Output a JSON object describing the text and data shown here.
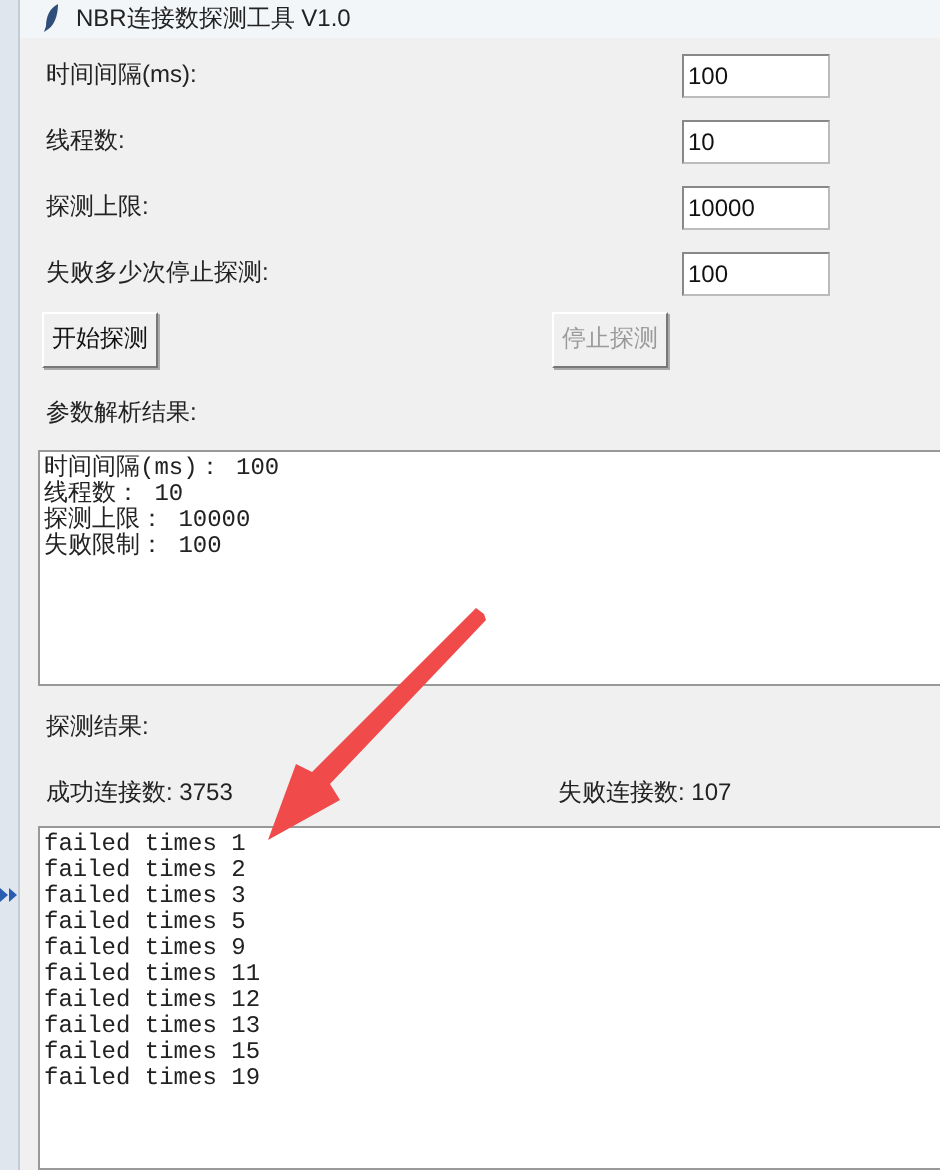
{
  "window": {
    "title": "NBR连接数探测工具 V1.0"
  },
  "fields": [
    {
      "label": "时间间隔(ms):",
      "value": "100"
    },
    {
      "label": "线程数:",
      "value": "10"
    },
    {
      "label": "探测上限:",
      "value": "10000"
    },
    {
      "label": "失败多少次停止探测:",
      "value": "100"
    }
  ],
  "buttons": [
    {
      "label": "开始探测",
      "disabled": false
    },
    {
      "label": "停止探测",
      "disabled": true
    }
  ],
  "parse_result": {
    "label": "参数解析结果:",
    "lines": [
      "时间间隔(ms)： 100",
      "线程数： 10",
      "探测上限： 10000",
      "失败限制： 100"
    ]
  },
  "probe_result": {
    "label": "探测结果:",
    "success": "成功连接数: 3753",
    "failed": "失败连接数: 107"
  },
  "log": [
    "failed times 1",
    "failed times 2",
    "failed times 3",
    "failed times 5",
    "failed times 9",
    "failed times 11",
    "failed times 12",
    "failed times 13",
    "failed times 15",
    "failed times 19"
  ],
  "annotations": [
    {
      "kind": "arrow"
    }
  ]
}
